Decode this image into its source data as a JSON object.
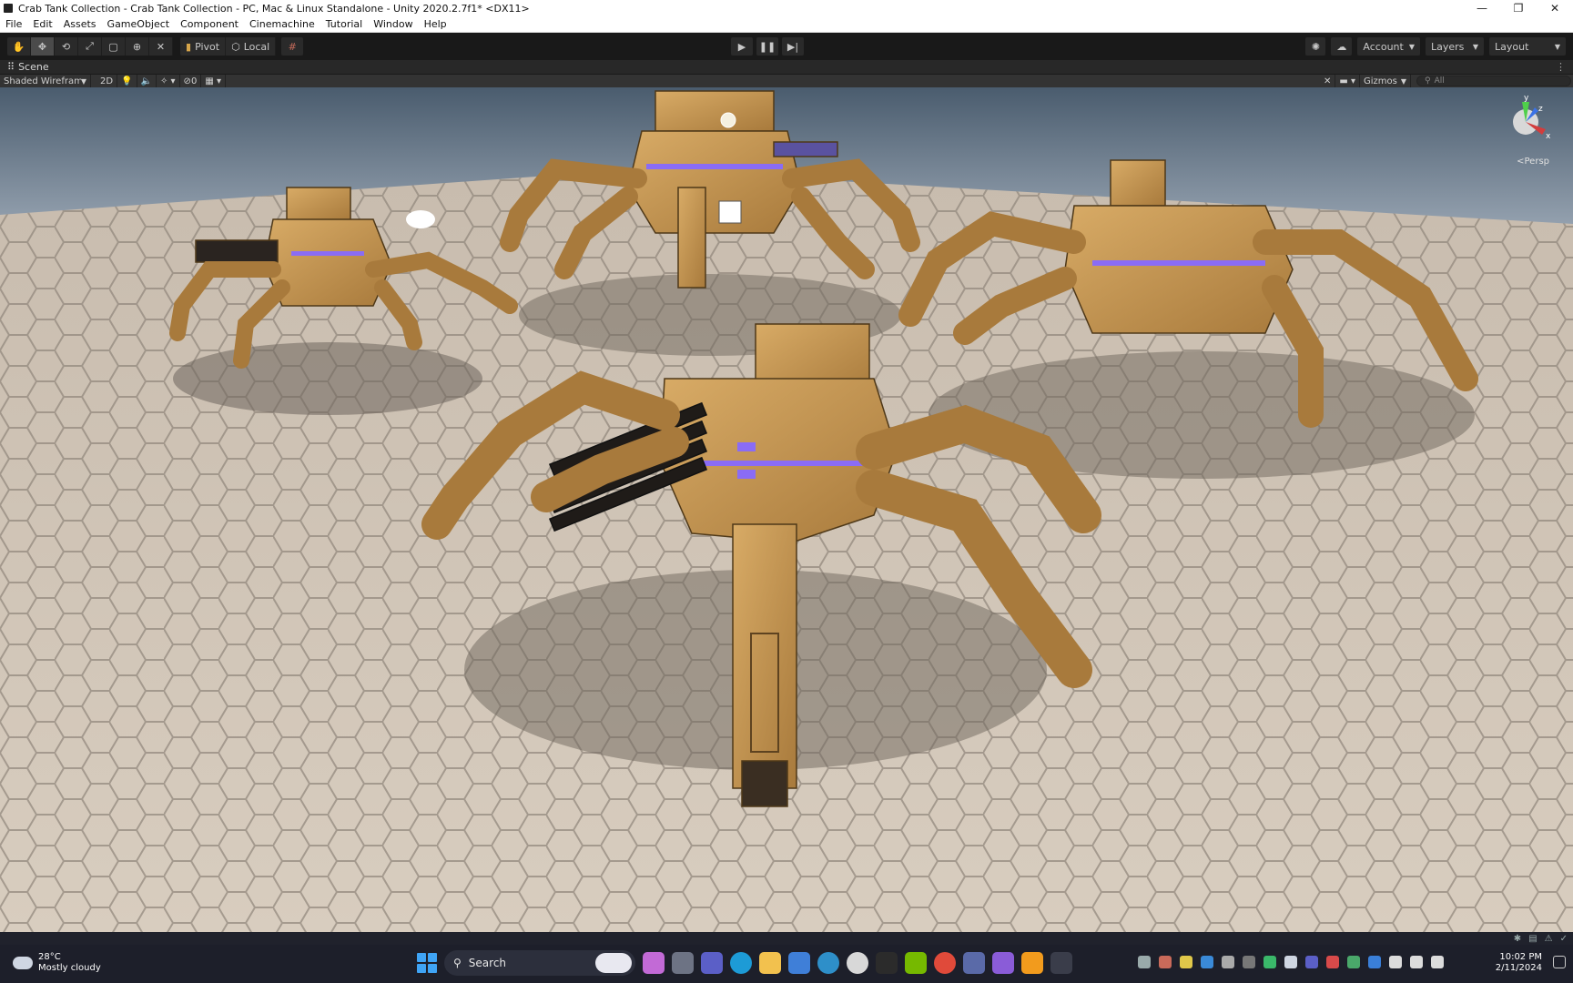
{
  "window": {
    "title": "Crab Tank Collection - Crab Tank Collection - PC, Mac & Linux Standalone - Unity 2020.2.7f1* <DX11>"
  },
  "menu": {
    "items": [
      "File",
      "Edit",
      "Assets",
      "GameObject",
      "Component",
      "Cinemachine",
      "Tutorial",
      "Window",
      "Help"
    ]
  },
  "toolbar": {
    "pivot_label": "Pivot",
    "local_label": "Local",
    "account_label": "Account",
    "layers_label": "Layers",
    "layout_label": "Layout"
  },
  "scene": {
    "tab_label": "Scene",
    "draw_mode": "Shaded Wireframe",
    "mode_2d": "2D",
    "hidden_count": "0",
    "gizmos_label": "Gizmos",
    "search_placeholder": "All",
    "persp_label": "<Persp"
  },
  "taskbar": {
    "weather_temp": "28°C",
    "weather_desc": "Mostly cloudy",
    "search_label": "Search",
    "time": "10:02 PM",
    "date": "2/11/2024"
  },
  "colors": {
    "tank_body": "#c99a57",
    "tank_dark": "#8a6530",
    "accent_glow": "#8a6cf5",
    "floor": "#cfc4b6",
    "sky_top": "#4f6173",
    "taskbar": "#1d1f2a"
  }
}
